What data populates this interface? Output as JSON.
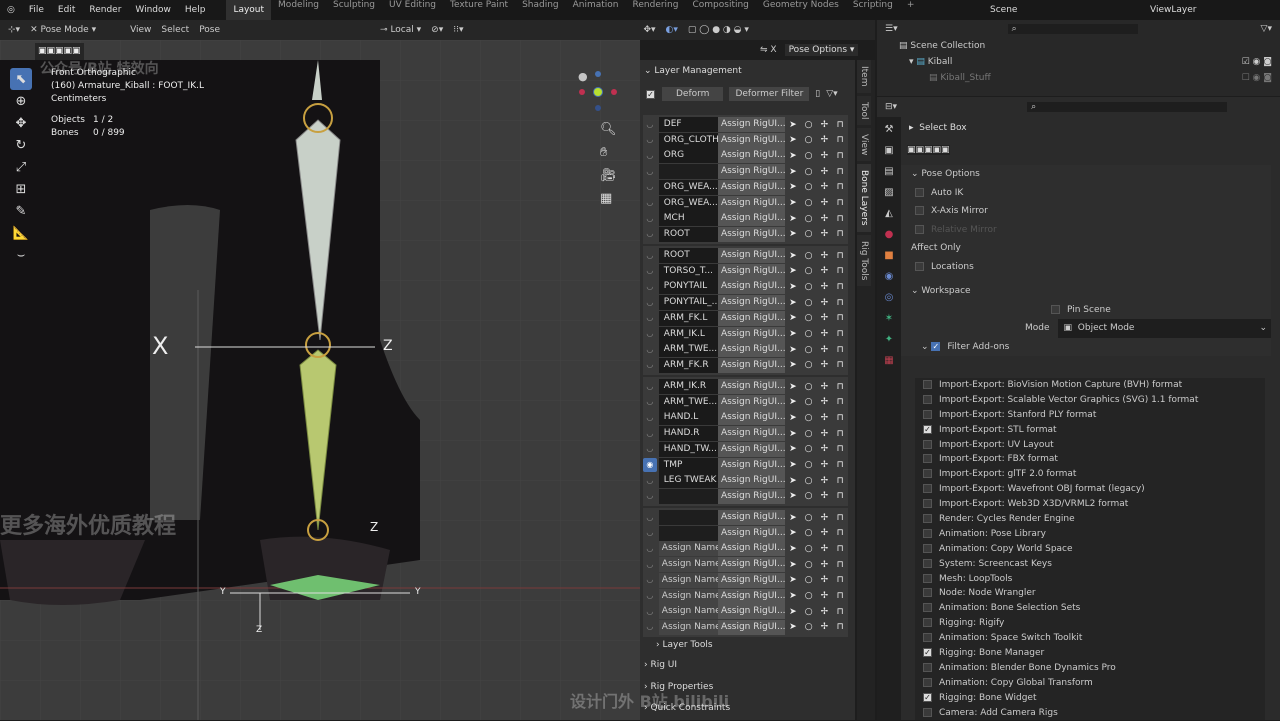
{
  "menu": [
    "File",
    "Edit",
    "Render",
    "Window",
    "Help"
  ],
  "workspaces": [
    "Layout",
    "Modeling",
    "Sculpting",
    "UV Editing",
    "Texture Paint",
    "Shading",
    "Animation",
    "Rendering",
    "Compositing",
    "Geometry Nodes",
    "Scripting",
    "+"
  ],
  "active_workspace": "Layout",
  "scene": "Scene",
  "view_layer": "ViewLayer",
  "viewport_header": {
    "mode": "Pose Mode",
    "menus": [
      "View",
      "Select",
      "Pose"
    ],
    "orientation": "Local",
    "pose_options": "Pose Options"
  },
  "overlay": {
    "view": "Front Orthographic",
    "object": "(160) Armature_Kiball : FOOT_IK.L",
    "units": "Centimeters",
    "objects_label": "Objects",
    "objects": "1 / 2",
    "bones_label": "Bones",
    "bones": "0 / 899"
  },
  "axes": {
    "x": "X",
    "z": "Z",
    "y": "Y"
  },
  "layer_mgmt": {
    "title": "Layer Management",
    "deform": "Deform",
    "deformer_filter": "Deformer Filter",
    "assign": "Assign RigUI...",
    "groups": [
      [
        "DEF",
        "ORG_CLOTH",
        "ORG",
        "",
        "ORG_WEA...",
        "ORG_WEA...",
        "MCH",
        "ROOT"
      ],
      [
        "ROOT",
        "TORSO_T...",
        "PONYTAIL",
        "PONYTAIL_...",
        "ARM_FK.L",
        "ARM_IK.L",
        "ARM_TWE...",
        "ARM_FK.R"
      ],
      [
        "ARM_IK.R",
        "ARM_TWE...",
        "HAND.L",
        "HAND.R",
        "HAND_TW...",
        "TMP",
        "LEG TWEAK",
        ""
      ],
      [
        "",
        "",
        "Assign Name",
        "Assign Name",
        "Assign Name",
        "Assign Name",
        "Assign Name",
        "Assign Name"
      ]
    ],
    "visible_layer": "TMP",
    "subpanels": [
      "Layer Tools",
      "Rig UI",
      "Rig Properties",
      "Quick Constraints"
    ]
  },
  "side_tabs": [
    "Item",
    "Tool",
    "View",
    "Bone Layers",
    "Rig Tools"
  ],
  "outliner": {
    "root": "Scene Collection",
    "items": [
      "Kiball",
      "Kiball_Stuff"
    ]
  },
  "props": {
    "tool": "Select Box",
    "pose_options": "Pose Options",
    "auto_ik": "Auto IK",
    "x_mirror": "X-Axis Mirror",
    "rel_mirror": "Relative Mirror",
    "affect_only": "Affect Only",
    "locations": "Locations",
    "workspace": "Workspace",
    "pin_scene": "Pin Scene",
    "mode_label": "Mode",
    "mode": "Object Mode",
    "filter_addons": "Filter Add-ons",
    "addons": [
      {
        "name": "Import-Export: BioVision Motion Capture (BVH) format",
        "on": false
      },
      {
        "name": "Import-Export: Scalable Vector Graphics (SVG) 1.1 format",
        "on": false
      },
      {
        "name": "Import-Export: Stanford PLY format",
        "on": false
      },
      {
        "name": "Import-Export: STL format",
        "on": true
      },
      {
        "name": "Import-Export: UV Layout",
        "on": false
      },
      {
        "name": "Import-Export: FBX format",
        "on": false
      },
      {
        "name": "Import-Export: glTF 2.0 format",
        "on": false
      },
      {
        "name": "Import-Export: Wavefront OBJ format (legacy)",
        "on": false
      },
      {
        "name": "Import-Export: Web3D X3D/VRML2 format",
        "on": false
      },
      {
        "name": "Render: Cycles Render Engine",
        "on": false
      },
      {
        "name": "Animation: Pose Library",
        "on": false
      },
      {
        "name": "Animation: Copy World Space",
        "on": false
      },
      {
        "name": "System: Screencast Keys",
        "on": false
      },
      {
        "name": "Mesh: LoopTools",
        "on": false
      },
      {
        "name": "Node: Node Wrangler",
        "on": false
      },
      {
        "name": "Animation: Bone Selection Sets",
        "on": false
      },
      {
        "name": "Rigging: Rigify",
        "on": false
      },
      {
        "name": "Animation: Space Switch Toolkit",
        "on": false
      },
      {
        "name": "Rigging: Bone Manager",
        "on": true
      },
      {
        "name": "Animation: Blender Bone Dynamics Pro",
        "on": false
      },
      {
        "name": "Animation: Copy Global Transform",
        "on": false
      },
      {
        "name": "Rigging: Bone Widget",
        "on": true
      },
      {
        "name": "Camera: Add Camera Rigs",
        "on": false
      }
    ]
  },
  "watermarks": [
    "公众号/B站 特效向",
    "更多海外优质教程",
    "设计门外 B站 bilibili"
  ],
  "colors": {
    "accent": "#4772b3",
    "bone": "#c8d0c8",
    "bone_selected": "#b8c870",
    "widget": "#6fbf6f"
  }
}
